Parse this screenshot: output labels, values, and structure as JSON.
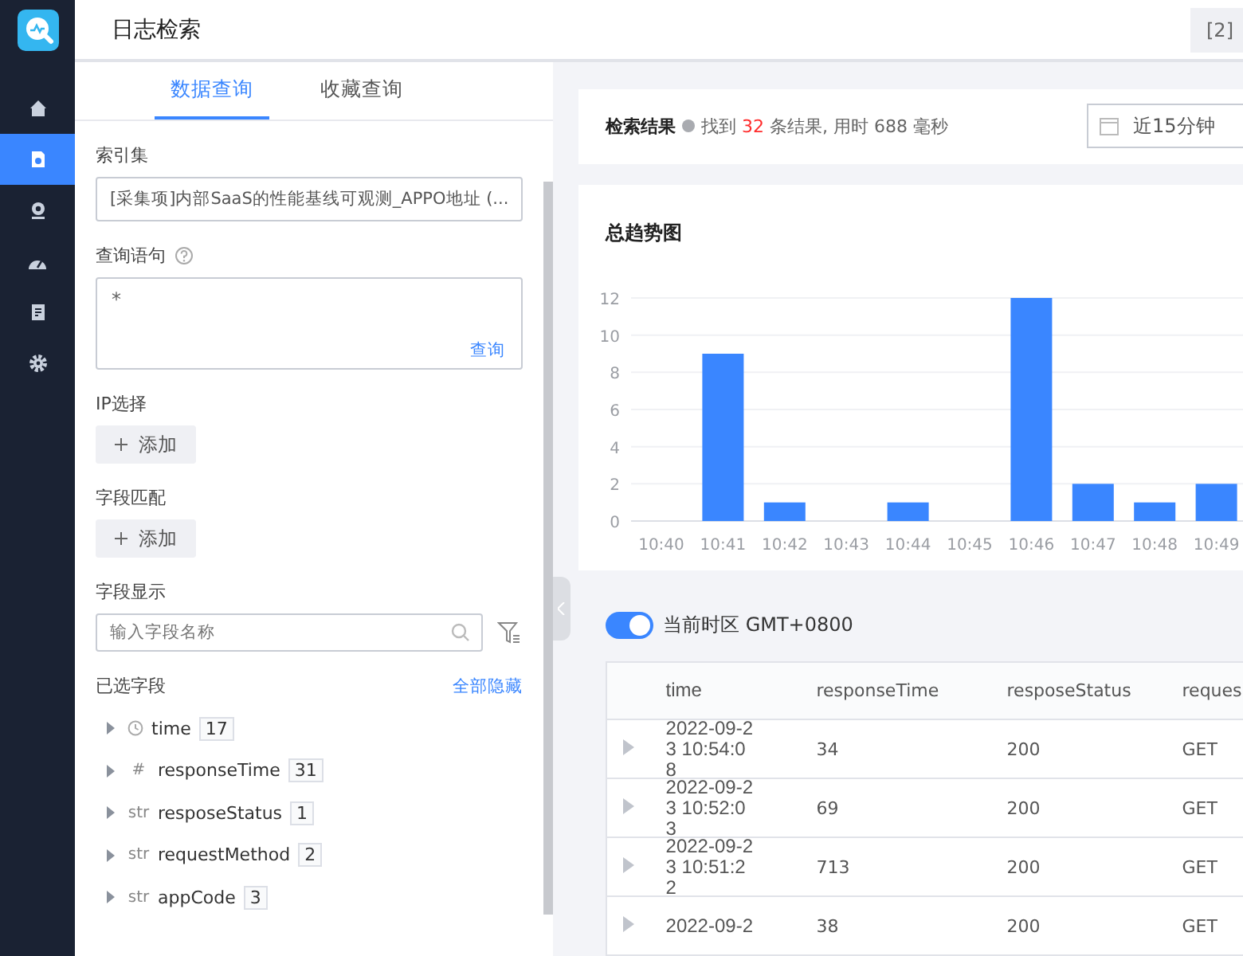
{
  "header": {
    "title": "日志检索",
    "button": "[2]"
  },
  "nav": {
    "items": [
      {
        "kind": "home",
        "selected": false
      },
      {
        "kind": "document",
        "selected": true
      },
      {
        "kind": "camera",
        "selected": false
      },
      {
        "kind": "gauge",
        "selected": false
      },
      {
        "kind": "report",
        "selected": false
      },
      {
        "kind": "settings",
        "selected": false
      }
    ]
  },
  "left": {
    "tabs": [
      {
        "label": "数据查询",
        "selected": true
      },
      {
        "label": "收藏查询",
        "selected": false
      }
    ],
    "index_set": {
      "label": "索引集",
      "value": "[采集项]内部SaaS的性能基线可观测_APPO地址 (..."
    },
    "query": {
      "label": "查询语句",
      "value": "*",
      "link": "查询"
    },
    "ip": {
      "label": "IP选择",
      "button": "添加"
    },
    "field_match": {
      "label": "字段匹配",
      "button": "添加"
    },
    "field_display": {
      "label": "字段显示",
      "placeholder": "输入字段名称"
    },
    "selected_fields": {
      "label": "已选字段",
      "link": "全部隐藏",
      "items": [
        {
          "kind": "time",
          "name": "time",
          "count": "17"
        },
        {
          "kind": "typed",
          "type": "#",
          "name": "responseTime",
          "count": "31"
        },
        {
          "kind": "typed",
          "type": "str",
          "name": "resposeStatus",
          "count": "1"
        },
        {
          "kind": "typed",
          "type": "str",
          "name": "requestMethod",
          "count": "2"
        },
        {
          "kind": "typed",
          "type": "str",
          "name": "appCode",
          "count": "3"
        }
      ]
    }
  },
  "results": {
    "label": "检索结果",
    "prefix": "找到",
    "count": "32",
    "suffix": "条结果, 用时 688 毫秒",
    "date_range": "近15分钟"
  },
  "trend": {
    "title": "总趋势图",
    "chart_data": {
      "type": "bar",
      "categories": [
        "10:40",
        "10:41",
        "10:42",
        "10:43",
        "10:44",
        "10:45",
        "10:46",
        "10:47",
        "10:48",
        "10:49"
      ],
      "values": [
        0,
        9,
        1,
        0,
        1,
        0,
        12,
        2,
        1,
        2
      ],
      "ylim": [
        0,
        12
      ],
      "yticks": [
        0,
        2,
        4,
        6,
        8,
        10,
        12
      ],
      "grid": true
    }
  },
  "timezone": {
    "on": true,
    "label": "当前时区 GMT+0800"
  },
  "table": {
    "columns": [
      "time",
      "responseTime",
      "resposeStatus",
      "reques"
    ],
    "rows": [
      {
        "cells": [
          "2022-09-23 10:54:08",
          "34",
          "200",
          "GET"
        ]
      },
      {
        "cells": [
          "2022-09-23 10:52:03",
          "69",
          "200",
          "GET"
        ]
      },
      {
        "cells": [
          "2022-09-23 10:51:22",
          "713",
          "200",
          "GET"
        ]
      },
      {
        "cells": [
          "2022-09-2",
          "38",
          "200",
          "GET"
        ]
      }
    ]
  }
}
